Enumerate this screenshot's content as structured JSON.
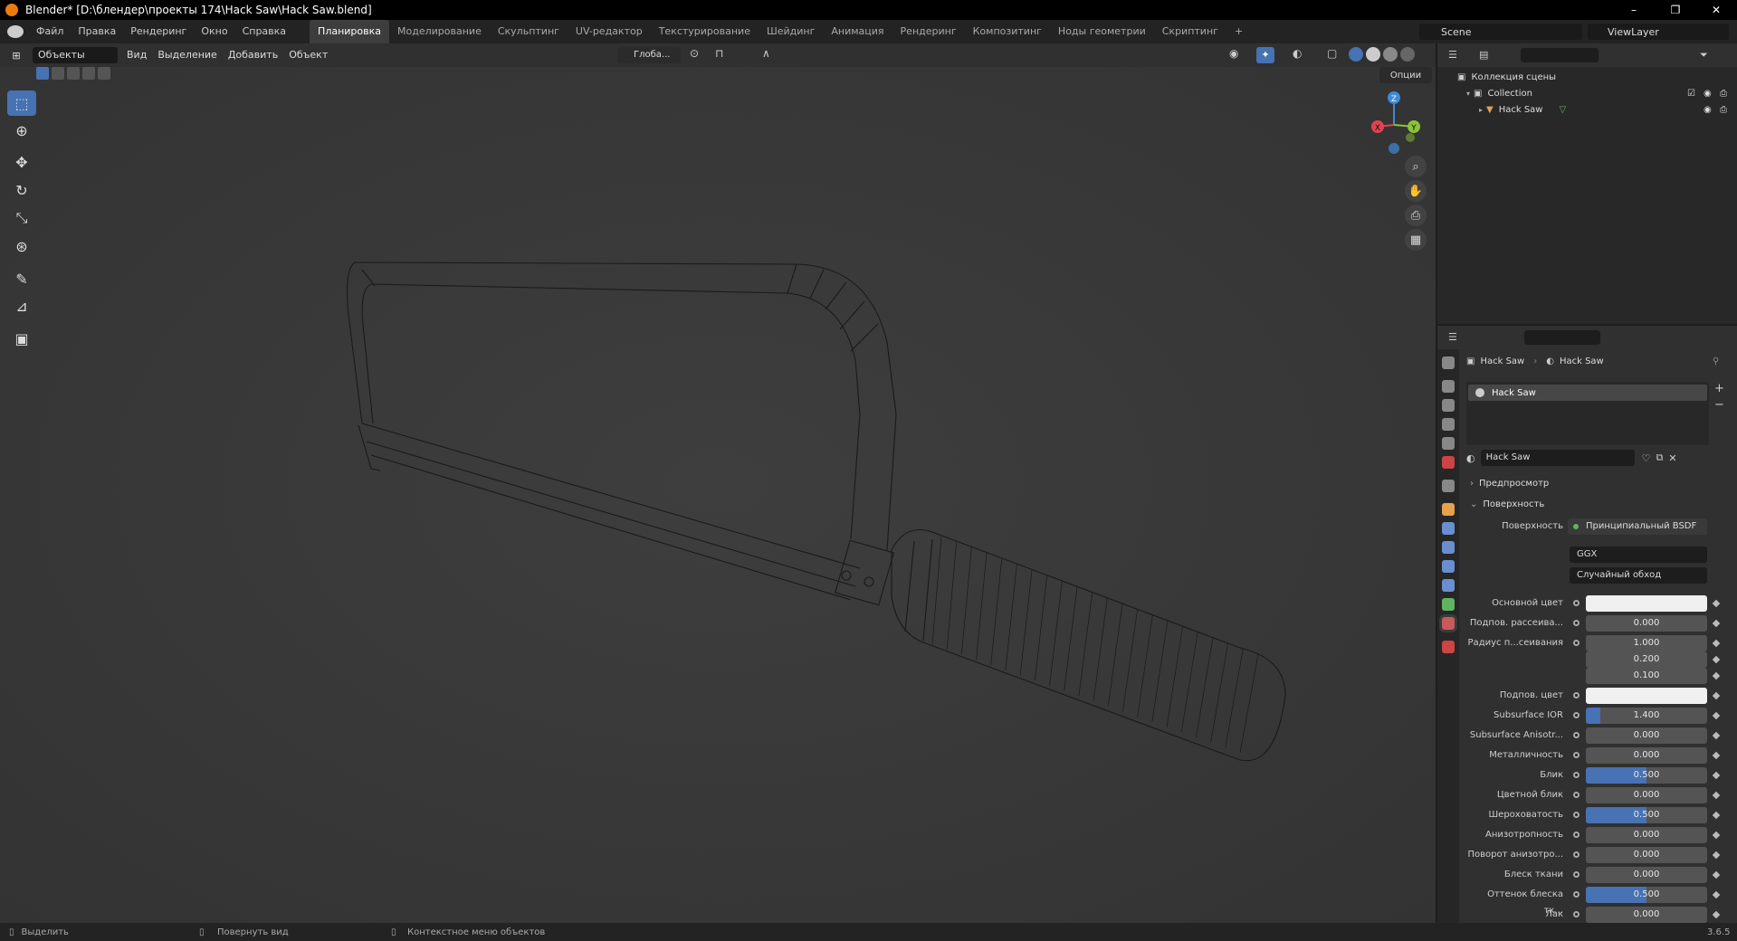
{
  "titlebar": {
    "title": "Blender* [D:\\блендер\\проекты 174\\Hack Saw\\Hack Saw.blend]",
    "minimize": "–",
    "maximize": "❐",
    "close": "✕"
  },
  "menu": {
    "items": [
      "Файл",
      "Правка",
      "Рендеринг",
      "Окно",
      "Справка"
    ]
  },
  "workspaces": [
    "Планировка",
    "Моделирование",
    "Скульптинг",
    "UV-редактор",
    "Текстурирование",
    "Шейдинг",
    "Анимация",
    "Рендеринг",
    "Композитинг",
    "Ноды геометрии",
    "Скриптинг"
  ],
  "workspace_add": "+",
  "scene": {
    "label": "Scene",
    "viewlayer": "ViewLayer"
  },
  "viewport_header": {
    "mode": "Объекты",
    "items": [
      "Вид",
      "Выделение",
      "Добавить",
      "Объект"
    ],
    "orientation": "Глоба...",
    "options": "Опции"
  },
  "gizmo": {
    "x": "X",
    "y": "Y",
    "z": "Z"
  },
  "outliner": {
    "root": "Коллекция сцены",
    "collection": "Collection",
    "object": "Hack Saw"
  },
  "properties": {
    "breadcrumb_object": "Hack Saw",
    "breadcrumb_material": "Hack Saw",
    "slot_name": "Hack Saw",
    "material_name": "Hack Saw",
    "sections": {
      "preview": "Предпросмотр",
      "surface": "Поверхность"
    },
    "surface_label": "Поверхность",
    "surface_value": "Принципиальный BSDF",
    "distribution": "GGX",
    "subsurface_method": "Случайный обход",
    "rows": [
      {
        "label": "Основной цвет",
        "value": "",
        "color": "#f0f0f0",
        "fill": 1
      },
      {
        "label": "Подпов. рассеива...",
        "value": "0.000",
        "fill": 0
      },
      {
        "label": "Радиус п...сеивания",
        "value": "1.000",
        "fill": 0
      },
      {
        "label": "",
        "value": "0.200",
        "fill": 0
      },
      {
        "label": "",
        "value": "0.100",
        "fill": 0
      },
      {
        "label": "Подпов. цвет",
        "value": "",
        "color": "#f0f0f0",
        "fill": 1
      },
      {
        "label": "Subsurface IOR",
        "value": "1.400",
        "fill": 0.12
      },
      {
        "label": "Subsurface Anisotr...",
        "value": "0.000",
        "fill": 0
      },
      {
        "label": "Металличность",
        "value": "0.000",
        "fill": 0
      },
      {
        "label": "Блик",
        "value": "0.500",
        "fill": 0.5
      },
      {
        "label": "Цветной блик",
        "value": "0.000",
        "fill": 0
      },
      {
        "label": "Шероховатость",
        "value": "0.500",
        "fill": 0.5
      },
      {
        "label": "Анизотропность",
        "value": "0.000",
        "fill": 0
      },
      {
        "label": "Поворот анизотро...",
        "value": "0.000",
        "fill": 0
      },
      {
        "label": "Блеск ткани",
        "value": "0.000",
        "fill": 0
      },
      {
        "label": "Оттенок блеска тк...",
        "value": "0.500",
        "fill": 0.5
      },
      {
        "label": "Лак",
        "value": "0.000",
        "fill": 0
      }
    ]
  },
  "status": {
    "select": "Выделить",
    "rotate": "Повернуть вид",
    "context": "Контекстное меню объектов",
    "version": "3.6.5"
  },
  "colors": {
    "accent": "#4772b3",
    "x_axis": "#e2434e",
    "y_axis": "#8ac437",
    "z_axis": "#3e8ad6"
  }
}
